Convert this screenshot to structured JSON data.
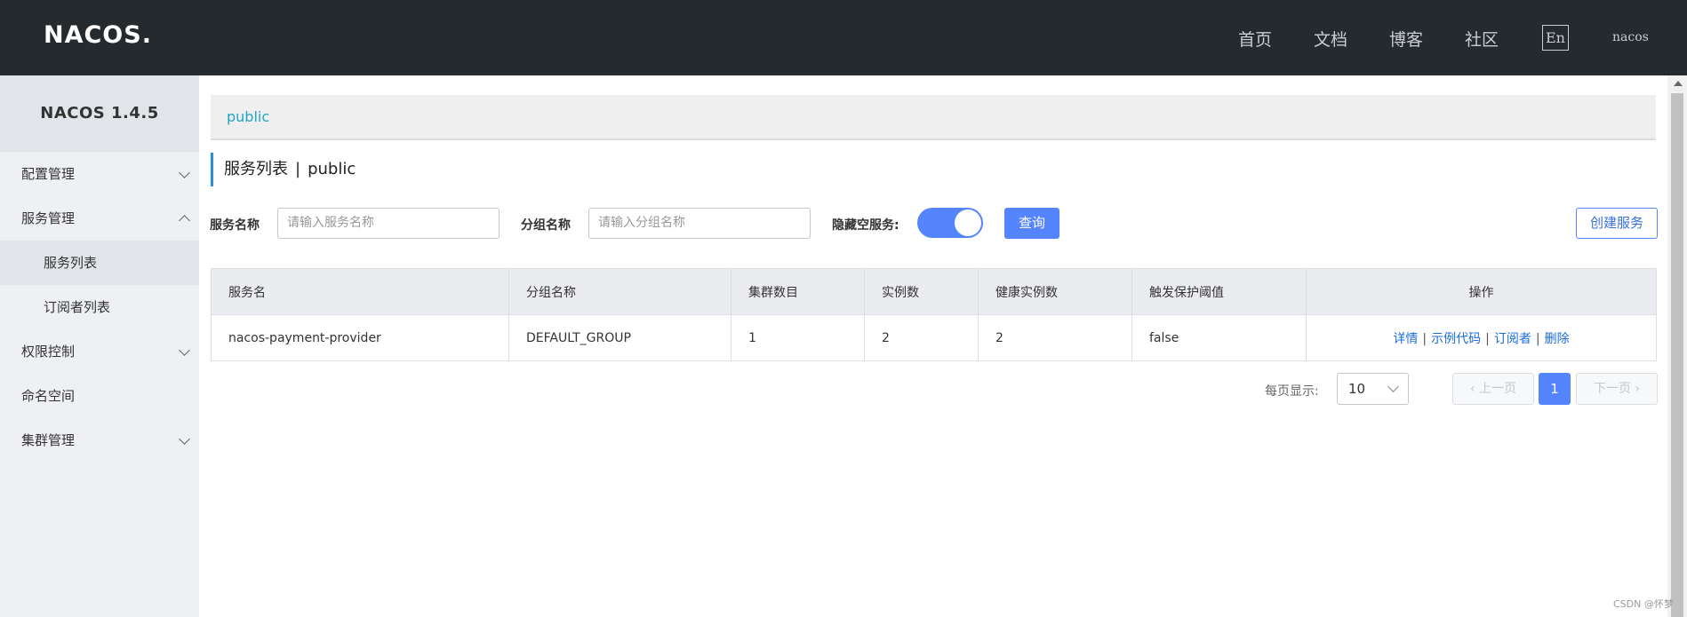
{
  "header": {
    "logo_text": "NACOS.",
    "nav": [
      "首页",
      "文档",
      "博客",
      "社区"
    ],
    "lang_button": "En",
    "user": "nacos"
  },
  "sidebar": {
    "title": "NACOS 1.4.5",
    "items": [
      {
        "label": "配置管理",
        "chevron": "down"
      },
      {
        "label": "服务管理",
        "chevron": "up"
      },
      {
        "label": "服务列表",
        "sub": true,
        "active": true
      },
      {
        "label": "订阅者列表",
        "sub": true
      },
      {
        "label": "权限控制",
        "chevron": "down"
      },
      {
        "label": "命名空间"
      },
      {
        "label": "集群管理",
        "chevron": "down"
      }
    ]
  },
  "breadcrumb": {
    "namespace": "public"
  },
  "page_title": {
    "main": "服务列表",
    "separator": "|",
    "namespace": "public"
  },
  "filters": {
    "service_name_label": "服务名称",
    "service_name_placeholder": "请输入服务名称",
    "group_name_label": "分组名称",
    "group_name_placeholder": "请输入分组名称",
    "hide_empty_label": "隐藏空服务:",
    "hide_empty_on": true,
    "query_button": "查询",
    "create_button": "创建服务"
  },
  "table": {
    "columns": [
      "服务名",
      "分组名称",
      "集群数目",
      "实例数",
      "健康实例数",
      "触发保护阈值",
      "操作"
    ],
    "rows": [
      {
        "service": "nacos-payment-provider",
        "group": "DEFAULT_GROUP",
        "clusters": "1",
        "instances": "2",
        "healthy": "2",
        "threshold": "false",
        "ops": [
          "详情",
          "示例代码",
          "订阅者",
          "删除"
        ]
      }
    ]
  },
  "pagination": {
    "page_size_label": "每页显示:",
    "page_size": "10",
    "prev": "上一页",
    "next": "下一页",
    "current": "1"
  },
  "watermark": "CSDN @怀梦",
  "colors": {
    "header_bg": "#252a2f",
    "primary": "#5584ff",
    "link": "#1a6cd6"
  }
}
